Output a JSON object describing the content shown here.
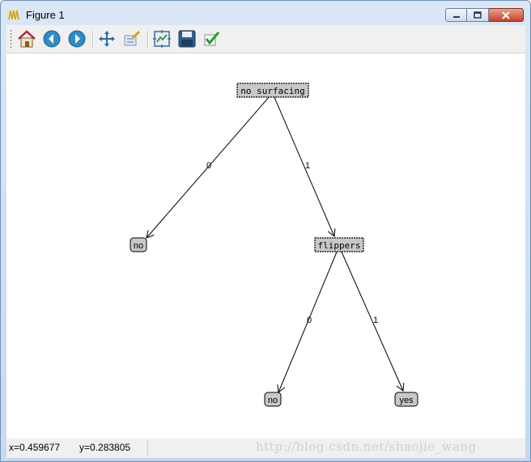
{
  "window": {
    "title": "Figure 1",
    "icon": "matplotlib-figure-icon",
    "controls": [
      "minimize-icon",
      "maximize-icon",
      "close-icon"
    ]
  },
  "toolbar": {
    "buttons": [
      {
        "name": "home",
        "icon": "home-icon"
      },
      {
        "name": "back",
        "icon": "back-arrow-icon"
      },
      {
        "name": "forward",
        "icon": "forward-arrow-icon"
      },
      {
        "name": "pan",
        "icon": "pan-icon"
      },
      {
        "name": "zoom",
        "icon": "zoom-rect-icon"
      },
      {
        "name": "subplots",
        "icon": "subplots-icon"
      },
      {
        "name": "save",
        "icon": "save-icon"
      },
      {
        "name": "edit",
        "icon": "checkmark-icon"
      }
    ]
  },
  "tree": {
    "root": "no surfacing",
    "root_left_edge": "0",
    "root_right_edge": "1",
    "left_leaf": "no",
    "right_node": "flippers",
    "right_left_edge": "0",
    "right_right_edge": "1",
    "right_left_leaf": "no",
    "right_right_leaf": "yes",
    "decision_fill": "#c8c8c8",
    "leaf_fill": "#c8c8c8"
  },
  "status": {
    "x": "x=0.459677",
    "y": "y=0.283805",
    "watermark": "http://blog.csdn.net/shaojie_wang"
  }
}
